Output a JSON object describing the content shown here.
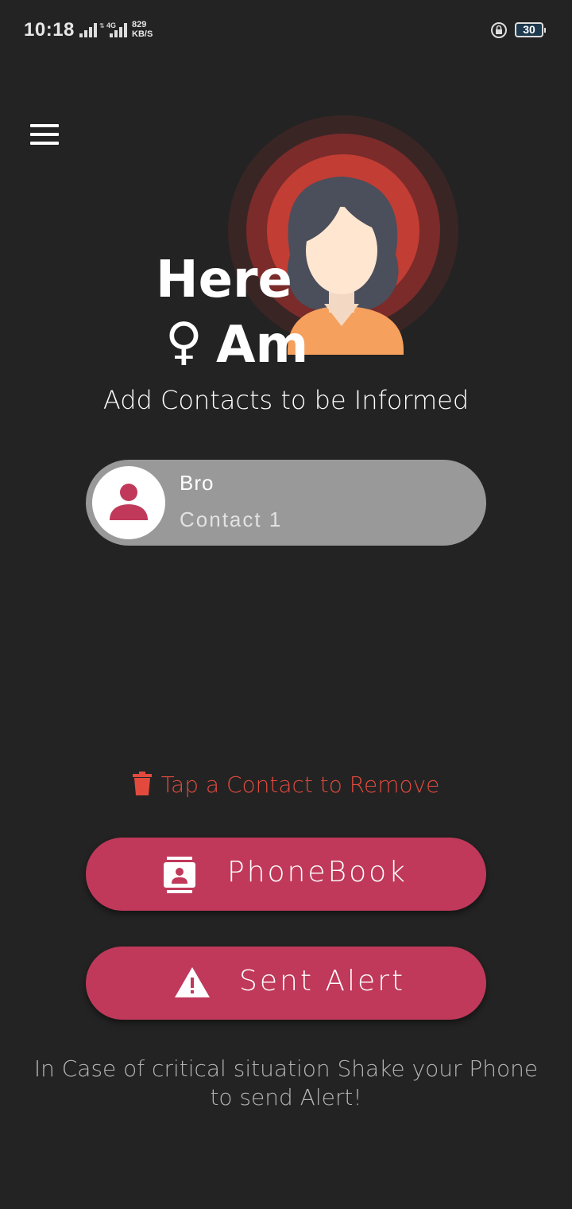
{
  "status_bar": {
    "time": "10:18",
    "network": "4G",
    "speed_value": "829",
    "speed_unit": "KB/S",
    "battery": "30"
  },
  "logo": {
    "line1": "Here",
    "line2": "Am",
    "symbol": "♀"
  },
  "subtitle": "Add Contacts to be Informed",
  "contacts": [
    {
      "name": "Bro",
      "label": "Contact 1"
    }
  ],
  "remove_hint": "Tap a Contact to Remove",
  "buttons": {
    "phonebook": "PhoneBook",
    "alert": "Sent Alert"
  },
  "footer": "In Case of critical situation Shake your Phone to send Alert!",
  "colors": {
    "background": "#232323",
    "accent": "#c0395a",
    "remove_hint": "#e24a3e",
    "contact_pill": "#999999"
  }
}
